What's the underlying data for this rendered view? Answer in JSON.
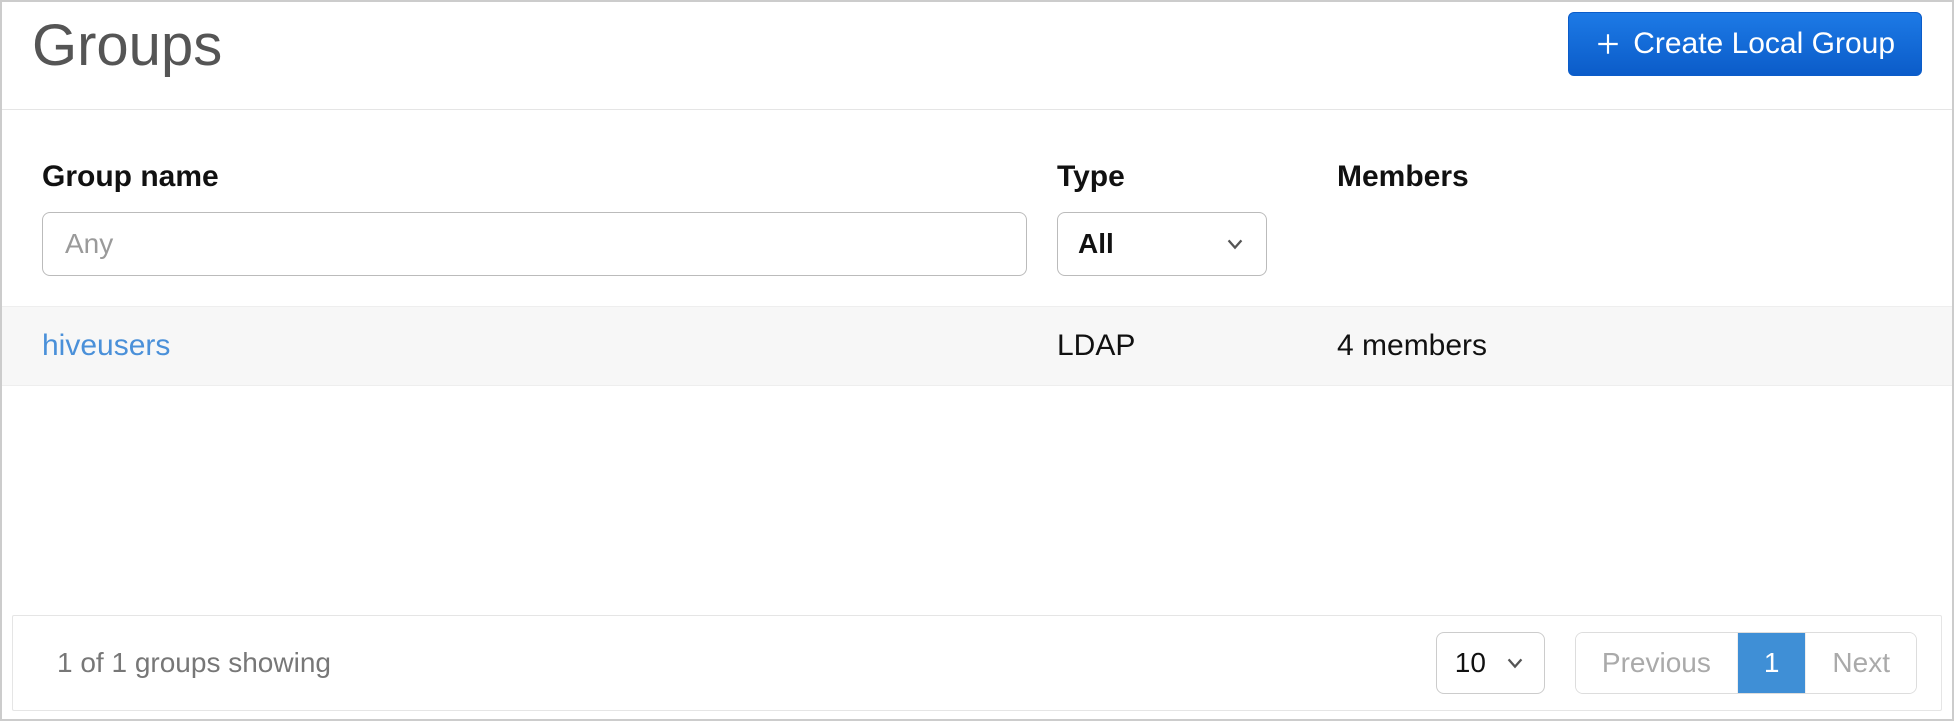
{
  "header": {
    "title": "Groups",
    "create_button": "Create Local Group"
  },
  "columns": {
    "name": "Group name",
    "type": "Type",
    "members": "Members"
  },
  "filters": {
    "name_placeholder": "Any",
    "type_selected": "All"
  },
  "rows": [
    {
      "name": "hiveusers",
      "type": "LDAP",
      "members": "4 members"
    }
  ],
  "footer": {
    "status": "1 of 1 groups showing",
    "page_size": "10",
    "prev": "Previous",
    "next": "Next",
    "current_page": "1"
  }
}
